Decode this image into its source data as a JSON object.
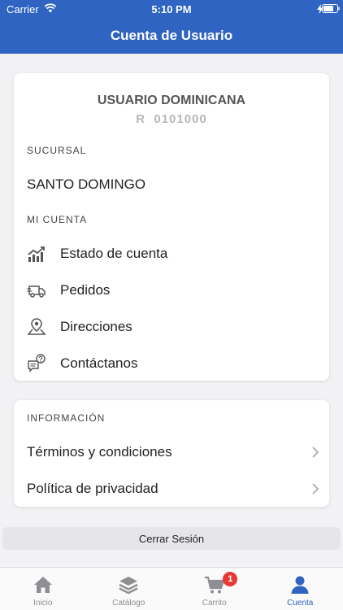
{
  "status_bar": {
    "carrier": "Carrier",
    "time": "5:10 PM"
  },
  "header": {
    "title": "Cuenta de Usuario",
    "bg_color": "#2f64c2"
  },
  "account": {
    "user_name": "USUARIO DOMINICANA",
    "user_code": "R  0101000",
    "branch_label": "SUCURSAL",
    "branch_value": "SANTO DOMINGO",
    "section_label": "MI CUENTA",
    "items": [
      {
        "label": "Estado de cuenta",
        "icon": "chart-trend-icon"
      },
      {
        "label": "Pedidos",
        "icon": "delivery-truck-icon"
      },
      {
        "label": "Direcciones",
        "icon": "map-pin-icon"
      },
      {
        "label": "Contáctanos",
        "icon": "chat-question-icon"
      }
    ]
  },
  "info": {
    "section_label": "INFORMACIÓN",
    "items": [
      {
        "label": "Términos y condiciones",
        "icon": "chevron-right-icon"
      },
      {
        "label": "Política de privacidad",
        "icon": "chevron-right-icon"
      }
    ]
  },
  "logout_label": "Cerrar Sesión",
  "tabs": [
    {
      "label": "Inicio",
      "icon": "home-icon"
    },
    {
      "label": "Catálogo",
      "icon": "layers-icon"
    },
    {
      "label": "Carrito",
      "icon": "cart-icon",
      "badge": "1"
    },
    {
      "label": "Cuenta",
      "icon": "user-icon",
      "active": true
    }
  ],
  "colors": {
    "accent": "#2f64c2",
    "badge": "#e53935",
    "inactive_tab": "#8e8e93"
  }
}
